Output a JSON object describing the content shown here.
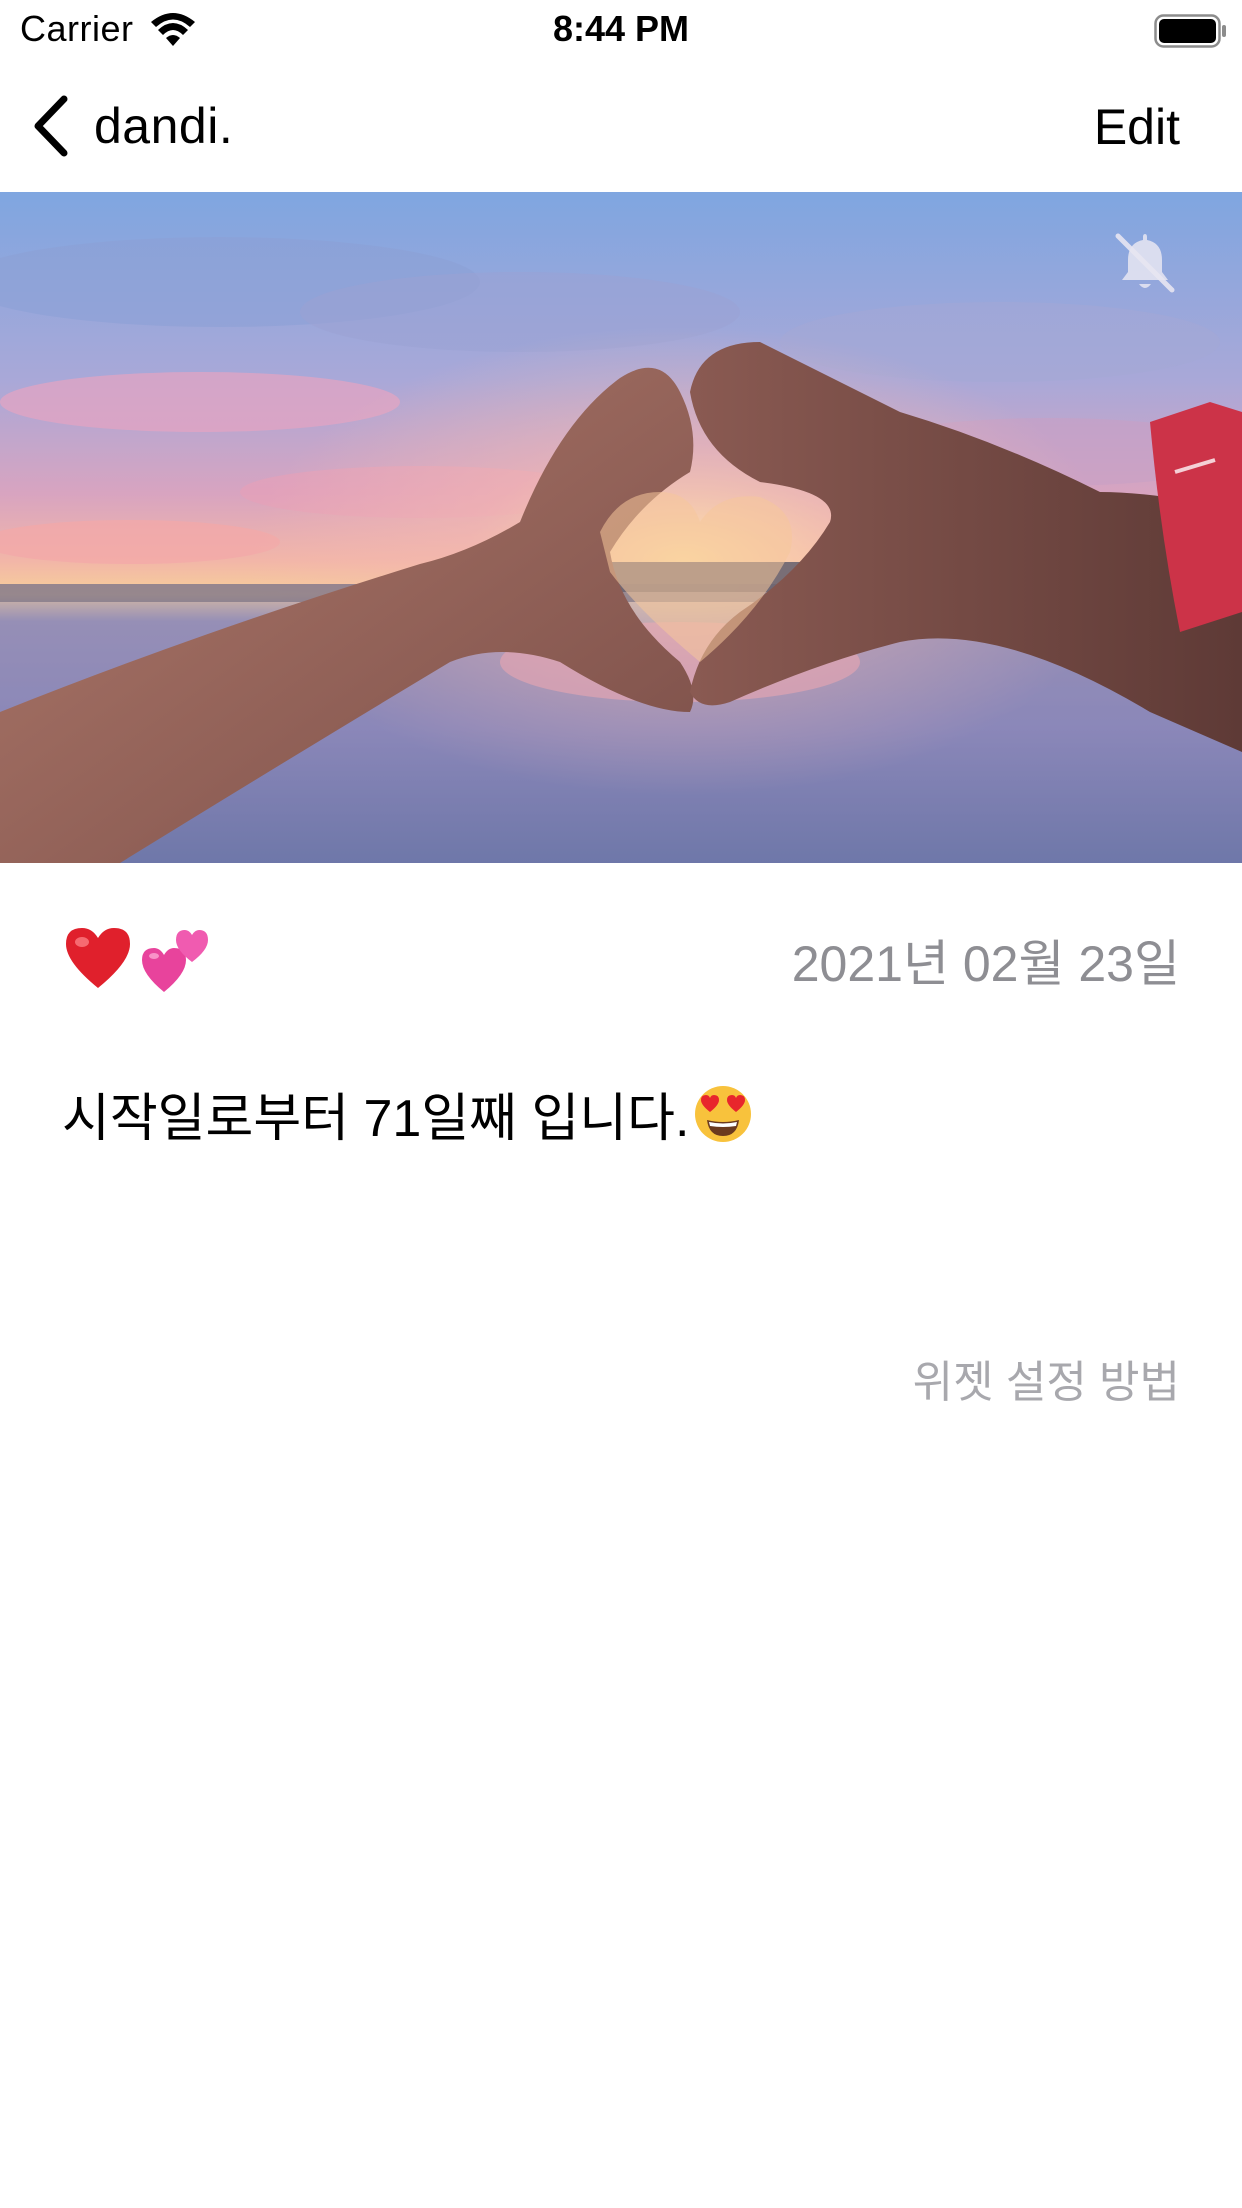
{
  "status_bar": {
    "carrier": "Carrier",
    "time": "8:44 PM",
    "wifi_icon": "wifi-icon",
    "battery_icon": "battery-full-icon"
  },
  "nav": {
    "back_label": "dandi.",
    "back_icon": "chevron-left-icon",
    "edit_label": "Edit"
  },
  "hero": {
    "image_subject": "hands forming a heart shape over sunset lake",
    "mute_icon": "bell-slash-icon"
  },
  "detail": {
    "emoji_icons": [
      "red-heart-emoji",
      "two-hearts-emoji"
    ],
    "date": "2021년 02월 23일",
    "dday_message": "시작일로부터 71일째 입니다.",
    "dday_emoji": "heart-eyes-emoji",
    "widget_help_link": "위젯 설정 방법"
  },
  "colors": {
    "background": "#ffffff",
    "primary_text": "#000000",
    "secondary_text": "#8e8e93",
    "link_text": "#a8a8ad"
  }
}
